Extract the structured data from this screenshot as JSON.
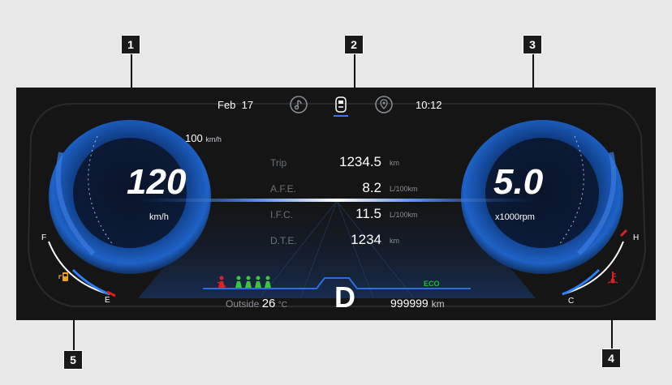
{
  "header": {
    "date": "Feb  17",
    "time": "10:12"
  },
  "header_icons": [
    "music-icon",
    "car-icon",
    "location-icon"
  ],
  "speed": {
    "limit_value": "100",
    "limit_unit": "km/h",
    "value": "120",
    "unit": "km/h"
  },
  "rpm": {
    "value": "5.0",
    "unit": "x1000rpm"
  },
  "trip_info": [
    {
      "label": "Trip",
      "value": "1234.5",
      "unit": "km"
    },
    {
      "label": "A.F.E.",
      "value": "8.2",
      "unit": "L/100km"
    },
    {
      "label": "I.F.C.",
      "value": "11.5",
      "unit": "L/100km"
    },
    {
      "label": "D.T.E.",
      "value": "1234",
      "unit": "km"
    }
  ],
  "gear": "D",
  "outside": {
    "label": "Outside",
    "value": "26",
    "unit": "°C"
  },
  "odometer": {
    "value": "999999",
    "unit": "km"
  },
  "eco": "ECO",
  "fuel_gauge": {
    "full": "F",
    "empty": "E"
  },
  "temp_gauge": {
    "hot": "H",
    "cold": "C"
  },
  "callouts": [
    "1",
    "2",
    "3",
    "4",
    "5"
  ],
  "colors": {
    "accent": "#2a7fff",
    "eco": "#1fbf3a",
    "warning": "#e02020",
    "seatbelt_ok": "#3ec43e"
  }
}
